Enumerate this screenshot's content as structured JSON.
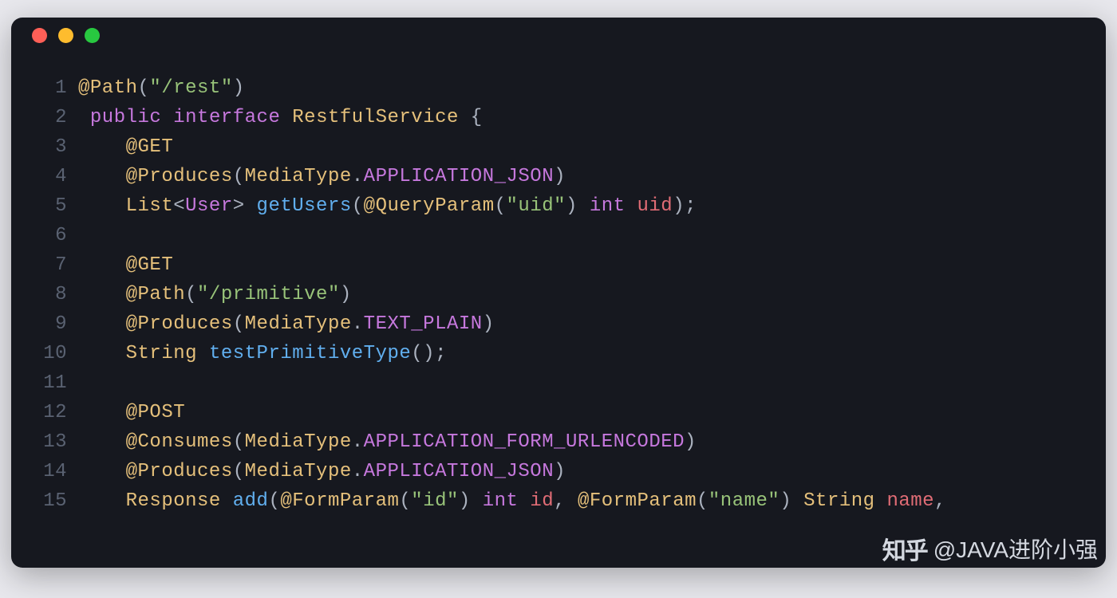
{
  "window": {
    "buttons": [
      "close",
      "minimize",
      "maximize"
    ]
  },
  "code": {
    "lines": [
      {
        "num": "1",
        "tokens": [
          {
            "c": "anno",
            "t": "@Path"
          },
          {
            "c": "punc",
            "t": "("
          },
          {
            "c": "str",
            "t": "\"/rest\""
          },
          {
            "c": "punc",
            "t": ")"
          }
        ]
      },
      {
        "num": "2",
        "indent": " ",
        "tokens": [
          {
            "c": "kw",
            "t": "public"
          },
          {
            "c": "punc",
            "t": " "
          },
          {
            "c": "kw",
            "t": "interface"
          },
          {
            "c": "punc",
            "t": " "
          },
          {
            "c": "cls",
            "t": "RestfulService"
          },
          {
            "c": "punc",
            "t": " {"
          }
        ]
      },
      {
        "num": "3",
        "indent": "    ",
        "tokens": [
          {
            "c": "anno",
            "t": "@GET"
          }
        ]
      },
      {
        "num": "4",
        "indent": "    ",
        "tokens": [
          {
            "c": "anno",
            "t": "@Produces"
          },
          {
            "c": "punc",
            "t": "("
          },
          {
            "c": "cls",
            "t": "MediaType"
          },
          {
            "c": "punc",
            "t": "."
          },
          {
            "c": "const",
            "t": "APPLICATION_JSON"
          },
          {
            "c": "punc",
            "t": ")"
          }
        ]
      },
      {
        "num": "5",
        "indent": "    ",
        "tokens": [
          {
            "c": "cls",
            "t": "List"
          },
          {
            "c": "punc",
            "t": "<"
          },
          {
            "c": "gen",
            "t": "User"
          },
          {
            "c": "punc",
            "t": "> "
          },
          {
            "c": "fn",
            "t": "getUsers"
          },
          {
            "c": "punc",
            "t": "("
          },
          {
            "c": "anno",
            "t": "@QueryParam"
          },
          {
            "c": "punc",
            "t": "("
          },
          {
            "c": "str",
            "t": "\"uid\""
          },
          {
            "c": "punc",
            "t": ") "
          },
          {
            "c": "typekw",
            "t": "int"
          },
          {
            "c": "punc",
            "t": " "
          },
          {
            "c": "id",
            "t": "uid"
          },
          {
            "c": "punc",
            "t": ");"
          }
        ]
      },
      {
        "num": "6",
        "tokens": []
      },
      {
        "num": "7",
        "indent": "    ",
        "tokens": [
          {
            "c": "anno",
            "t": "@GET"
          }
        ]
      },
      {
        "num": "8",
        "indent": "    ",
        "tokens": [
          {
            "c": "anno",
            "t": "@Path"
          },
          {
            "c": "punc",
            "t": "("
          },
          {
            "c": "str",
            "t": "\"/primitive\""
          },
          {
            "c": "punc",
            "t": ")"
          }
        ]
      },
      {
        "num": "9",
        "indent": "    ",
        "tokens": [
          {
            "c": "anno",
            "t": "@Produces"
          },
          {
            "c": "punc",
            "t": "("
          },
          {
            "c": "cls",
            "t": "MediaType"
          },
          {
            "c": "punc",
            "t": "."
          },
          {
            "c": "const",
            "t": "TEXT_PLAIN"
          },
          {
            "c": "punc",
            "t": ")"
          }
        ]
      },
      {
        "num": "10",
        "indent": "    ",
        "tokens": [
          {
            "c": "cls",
            "t": "String"
          },
          {
            "c": "punc",
            "t": " "
          },
          {
            "c": "fn",
            "t": "testPrimitiveType"
          },
          {
            "c": "punc",
            "t": "();"
          }
        ]
      },
      {
        "num": "11",
        "tokens": []
      },
      {
        "num": "12",
        "indent": "    ",
        "tokens": [
          {
            "c": "anno",
            "t": "@POST"
          }
        ]
      },
      {
        "num": "13",
        "indent": "    ",
        "tokens": [
          {
            "c": "anno",
            "t": "@Consumes"
          },
          {
            "c": "punc",
            "t": "("
          },
          {
            "c": "cls",
            "t": "MediaType"
          },
          {
            "c": "punc",
            "t": "."
          },
          {
            "c": "const",
            "t": "APPLICATION_FORM_URLENCODED"
          },
          {
            "c": "punc",
            "t": ")"
          }
        ]
      },
      {
        "num": "14",
        "indent": "    ",
        "tokens": [
          {
            "c": "anno",
            "t": "@Produces"
          },
          {
            "c": "punc",
            "t": "("
          },
          {
            "c": "cls",
            "t": "MediaType"
          },
          {
            "c": "punc",
            "t": "."
          },
          {
            "c": "const",
            "t": "APPLICATION_JSON"
          },
          {
            "c": "punc",
            "t": ")"
          }
        ]
      },
      {
        "num": "15",
        "indent": "    ",
        "tokens": [
          {
            "c": "cls",
            "t": "Response"
          },
          {
            "c": "punc",
            "t": " "
          },
          {
            "c": "fn",
            "t": "add"
          },
          {
            "c": "punc",
            "t": "("
          },
          {
            "c": "anno",
            "t": "@FormParam"
          },
          {
            "c": "punc",
            "t": "("
          },
          {
            "c": "str",
            "t": "\"id\""
          },
          {
            "c": "punc",
            "t": ") "
          },
          {
            "c": "typekw",
            "t": "int"
          },
          {
            "c": "punc",
            "t": " "
          },
          {
            "c": "id",
            "t": "id"
          },
          {
            "c": "punc",
            "t": ", "
          },
          {
            "c": "anno",
            "t": "@FormParam"
          },
          {
            "c": "punc",
            "t": "("
          },
          {
            "c": "str",
            "t": "\"name\""
          },
          {
            "c": "punc",
            "t": ") "
          },
          {
            "c": "cls",
            "t": "String"
          },
          {
            "c": "punc",
            "t": " "
          },
          {
            "c": "id",
            "t": "name"
          },
          {
            "c": "punc",
            "t": ","
          }
        ]
      }
    ]
  },
  "watermark": {
    "logo": "知乎",
    "text": "@JAVA进阶小强"
  }
}
